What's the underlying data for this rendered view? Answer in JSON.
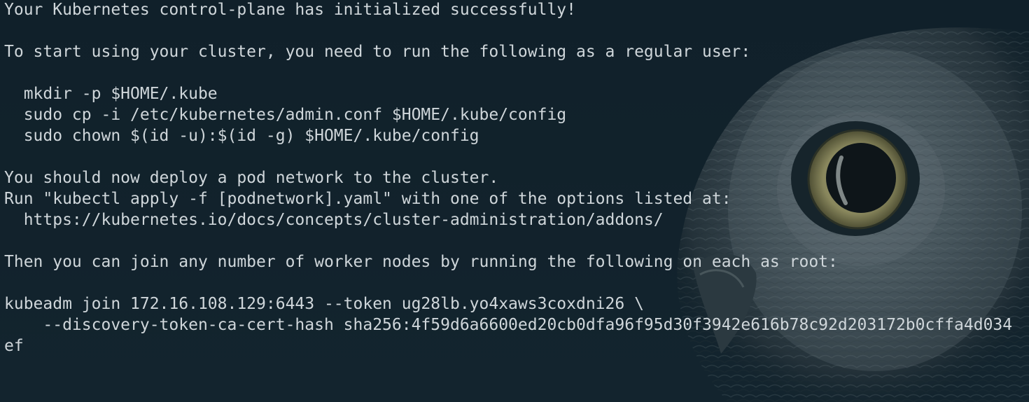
{
  "terminal": {
    "background": "#13212a",
    "text_color": "#cfd6da",
    "background_image": "owl-photo",
    "lines": [
      "Your Kubernetes control-plane has initialized successfully!",
      "",
      "To start using your cluster, you need to run the following as a regular user:",
      "",
      "  mkdir -p $HOME/.kube",
      "  sudo cp -i /etc/kubernetes/admin.conf $HOME/.kube/config",
      "  sudo chown $(id -u):$(id -g) $HOME/.kube/config",
      "",
      "You should now deploy a pod network to the cluster.",
      "Run \"kubectl apply -f [podnetwork].yaml\" with one of the options listed at:",
      "  https://kubernetes.io/docs/concepts/cluster-administration/addons/",
      "",
      "Then you can join any number of worker nodes by running the following on each as root:",
      "",
      "kubeadm join 172.16.108.129:6443 --token ug28lb.yo4xaws3coxdni26 \\",
      "    --discovery-token-ca-cert-hash sha256:4f59d6a6600ed20cb0dfa96f95d30f3942e616b78c92d203172b0cffa4d034",
      "ef"
    ]
  }
}
